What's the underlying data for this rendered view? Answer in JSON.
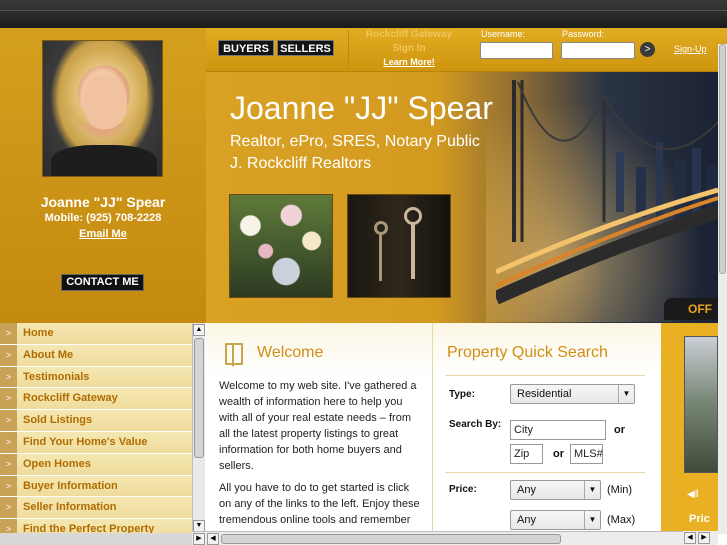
{
  "agent": {
    "name": "Joanne \"JJ\" Spear",
    "mobile": "Mobile: (925) 708-2228",
    "email_label": "Email Me",
    "contact_label": "CONTACT ME"
  },
  "header": {
    "buyers_label": "BUYERS",
    "sellers_label": "SELLERS",
    "gateway_title": "Rockcliff Gateway Sign In",
    "gateway_link": "Learn More!",
    "username_label": "Username:",
    "password_label": "Password:",
    "username_value": "",
    "password_value": "",
    "go_label": ">",
    "signup_label": "Sign-Up"
  },
  "hero": {
    "name": "Joanne \"JJ\" Spear",
    "subtitle1": "Realtor, ePro, SRES, Notary Public",
    "subtitle2": "J. Rockcliff Realtors",
    "offer_tab": "OFF"
  },
  "nav": {
    "items": [
      "Home",
      "About Me",
      "Testimonials",
      "Rockcliff Gateway",
      "Sold Listings",
      "Find Your Home's Value",
      "Open Homes",
      "Buyer Information",
      "Seller Information",
      "Find the Perfect Property"
    ]
  },
  "welcome": {
    "title": "Welcome",
    "paragraph1": "Welcome to my web site. I've gathered a wealth of information here to help you with all of your real estate needs – from all the latest property listings to great information for both home buyers and sellers.",
    "paragraph2": "All you have to do to get started is click on any of the links to the left. Enjoy these tremendous online tools and remember that you can also count on"
  },
  "quick_search": {
    "title": "Property Quick Search",
    "type_label": "Type:",
    "type_value": "Residential",
    "search_by_label": "Search By:",
    "city_placeholder": "City",
    "or1": "or",
    "zip_placeholder": "Zip",
    "or2": "or",
    "mls_placeholder": "MLS#",
    "price_label": "Price:",
    "min_value": "Any",
    "min_suffix": "(Min)",
    "max_value": "Any",
    "max_suffix": "(Max)"
  },
  "slide": {
    "control": "◀‖",
    "price_label": "Pric"
  },
  "colors": {
    "gold": "#d59f1e",
    "nav_text": "#b06c00",
    "title_orange": "#d08e17"
  }
}
